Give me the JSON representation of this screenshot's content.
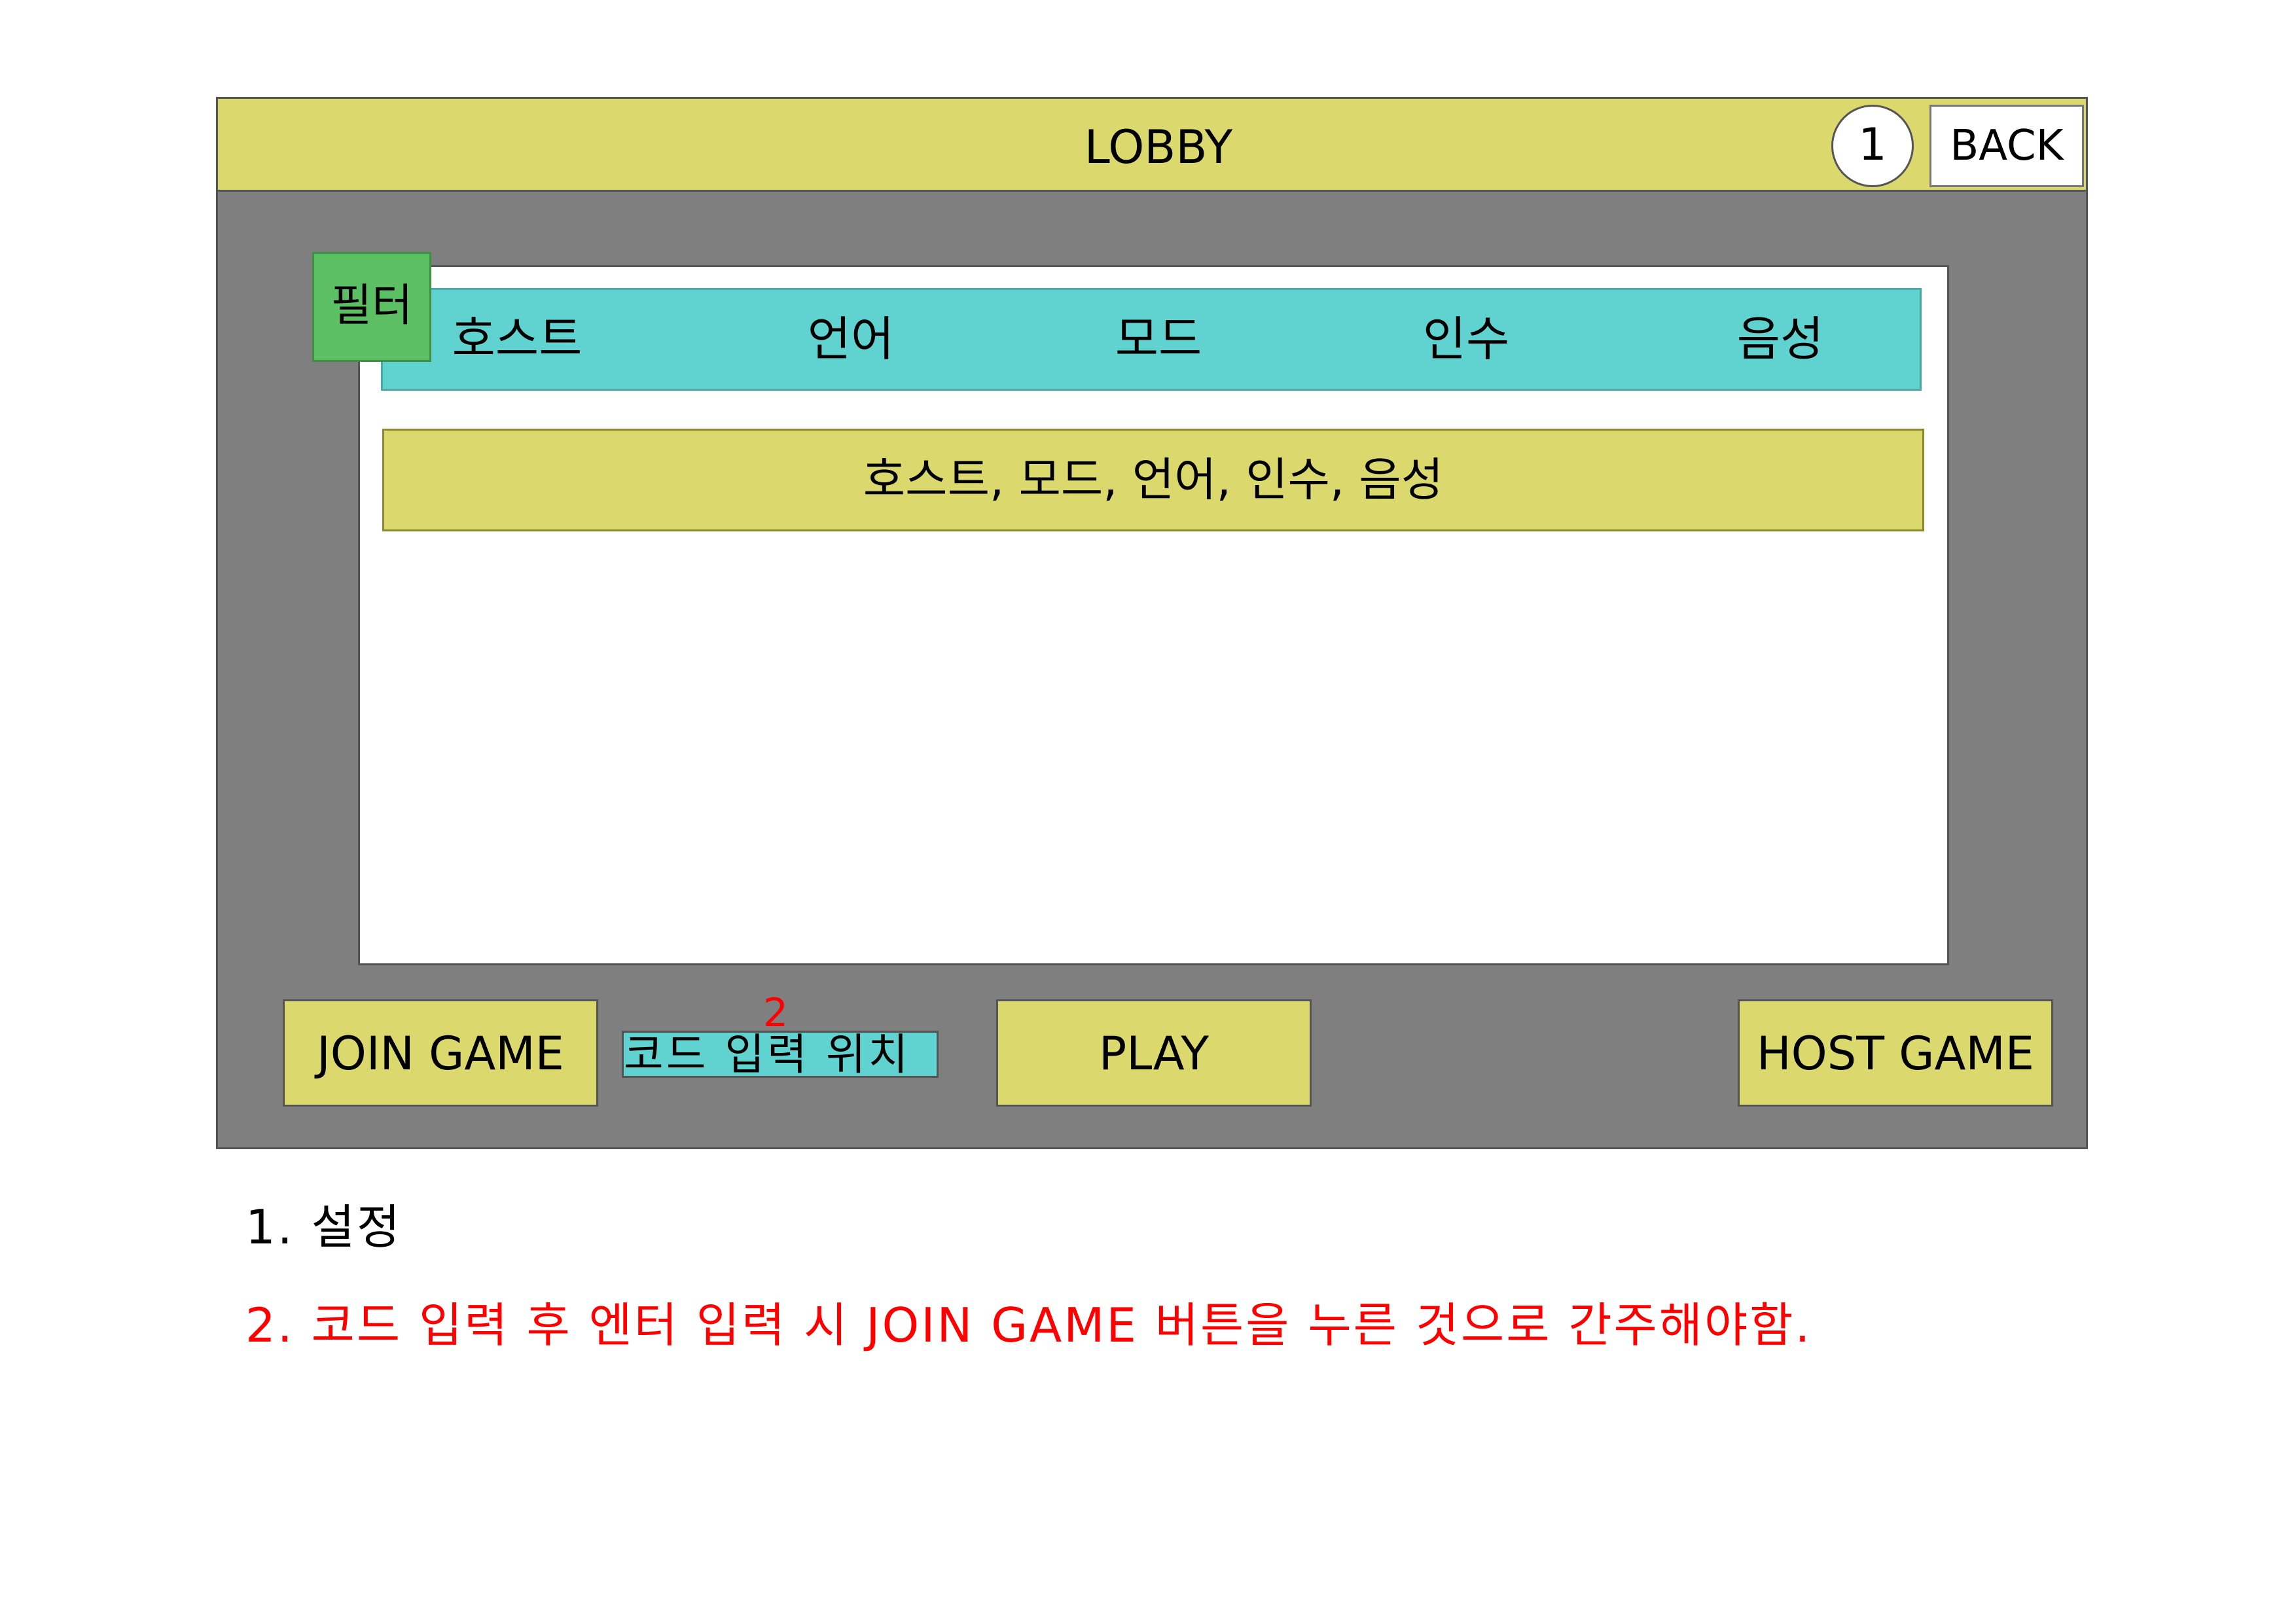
{
  "screen": {
    "title": "LOBBY",
    "settings_badge": "1",
    "back_label": "BACK"
  },
  "list": {
    "filter_label": "필터",
    "columns": [
      "호스트",
      "언어",
      "모드",
      "인수",
      "음성"
    ],
    "rows": [
      {
        "text": "호스트, 모드, 언어, 인수, 음성"
      }
    ]
  },
  "actions": {
    "join_label": "JOIN GAME",
    "code_placeholder": "코드 입력 위치",
    "code_marker": "2",
    "play_label": "PLAY",
    "host_label": "HOST GAME"
  },
  "notes": [
    "1. 설정",
    "2. 코드 입력 후 엔터 입력 시 JOIN GAME 버튼을 누른 것으로 간주해야함."
  ],
  "colors": {
    "panel_bg": "#7f7f7f",
    "bar_yellow": "#dbd96e",
    "header_cyan": "#60d3d0",
    "filter_green": "#5dbf63",
    "note_red": "#ff0000"
  }
}
